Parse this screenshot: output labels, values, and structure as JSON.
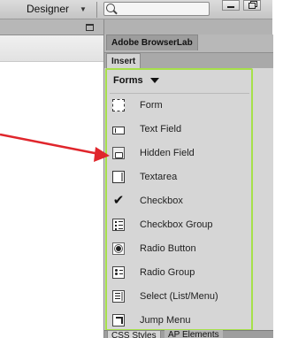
{
  "toolbar": {
    "workspace_label": "Designer",
    "search_value": "",
    "search_icon": "search-icon",
    "minimize_icon": "minimize-icon",
    "restore_icon": "restore-icon"
  },
  "document": {
    "restore_icon": "restore-icon"
  },
  "panels": {
    "tabs": [
      "Adobe BrowserLab",
      "Insert"
    ],
    "insert": {
      "category": "Forms",
      "items": [
        {
          "label": "Form",
          "icon": "form-icon"
        },
        {
          "label": "Text Field",
          "icon": "text-field-icon"
        },
        {
          "label": "Hidden Field",
          "icon": "hidden-field-icon"
        },
        {
          "label": "Textarea",
          "icon": "textarea-icon"
        },
        {
          "label": "Checkbox",
          "icon": "checkbox-icon"
        },
        {
          "label": "Checkbox Group",
          "icon": "checkbox-group-icon"
        },
        {
          "label": "Radio Button",
          "icon": "radio-button-icon"
        },
        {
          "label": "Radio Group",
          "icon": "radio-group-icon"
        },
        {
          "label": "Select (List/Menu)",
          "icon": "select-icon"
        },
        {
          "label": "Jump Menu",
          "icon": "jump-menu-icon"
        }
      ]
    },
    "bottom_tabs": [
      "CSS Styles",
      "AP Elements"
    ]
  },
  "colors": {
    "highlight": "#a6e04a",
    "annotation_arrow": "#e0262c"
  }
}
